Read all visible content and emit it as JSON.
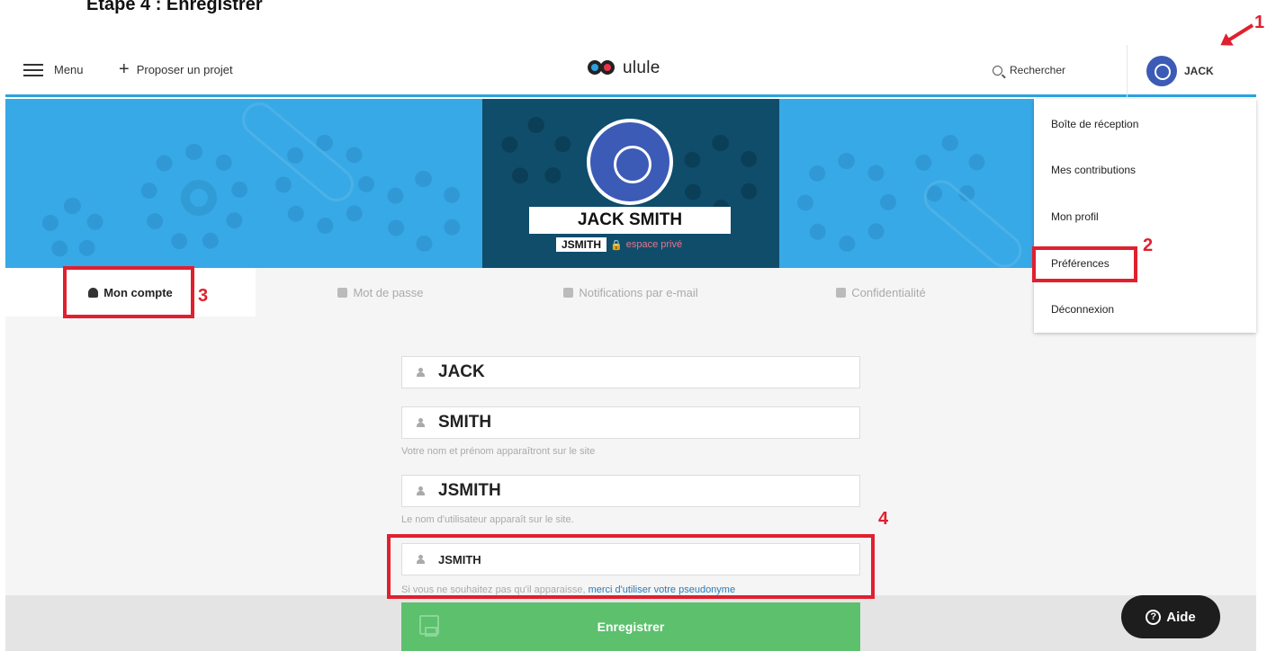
{
  "step_title": "Etape 4 : Enregistrer",
  "nav": {
    "menu_label": "Menu",
    "propose_label": "Proposer un projet",
    "logo_text": "ulule",
    "search_label": "Rechercher",
    "user_label": "JACK"
  },
  "banner": {
    "full_name": "JACK SMITH",
    "handle": "JSMITH",
    "private_label": "espace privé"
  },
  "tabs": [
    {
      "label": "Mon compte",
      "icon": "user-icon",
      "active": true
    },
    {
      "label": "Mot de passe",
      "icon": "lock-icon",
      "active": false
    },
    {
      "label": "Notifications par e-mail",
      "icon": "bell-icon",
      "active": false
    },
    {
      "label": "Confidentialité",
      "icon": "umbrella-icon",
      "active": false
    }
  ],
  "form": {
    "first_name": "JACK",
    "last_name": "SMITH",
    "name_hint": "Votre nom et prénom apparaîtront sur le site",
    "username": "JSMITH",
    "username_hint": "Le nom d'utilisateur apparaît sur le site.",
    "pseudonym": "JSMITH",
    "pseudonym_hint": "Si vous ne souhaitez pas qu'il apparaisse,",
    "pseudonym_link": "merci d'utiliser votre pseudonyme",
    "save_label": "Enregistrer"
  },
  "help_label": "Aide",
  "dropdown": {
    "items": [
      "Boîte de réception",
      "Mes contributions",
      "Mon profil",
      "Préférences",
      "Déconnexion"
    ]
  },
  "annotations": [
    "1",
    "2",
    "3",
    "4"
  ],
  "colors": {
    "accent": "#2aa2e0",
    "save_green": "#5cc06d",
    "annotation_red": "#e0202e",
    "avatar_blue": "#3c5bb7"
  }
}
